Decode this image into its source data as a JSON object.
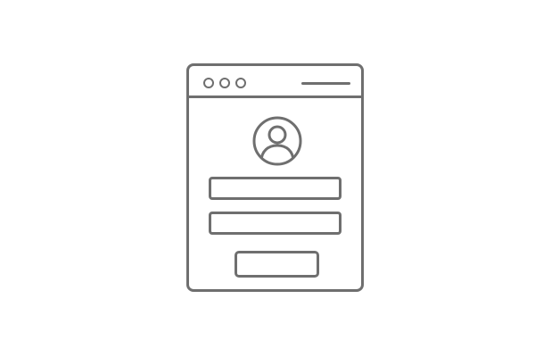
{
  "window": {
    "title_bar": {
      "controls": [
        "window-dot",
        "window-dot",
        "window-dot"
      ],
      "title_placeholder_icon": "title-line"
    },
    "avatar_icon": "user-avatar-icon",
    "form": {
      "fields": [
        "username-field",
        "password-field"
      ],
      "submit": "login-button"
    }
  },
  "colors": {
    "stroke": "#6f6f6f",
    "background": "#ffffff"
  }
}
